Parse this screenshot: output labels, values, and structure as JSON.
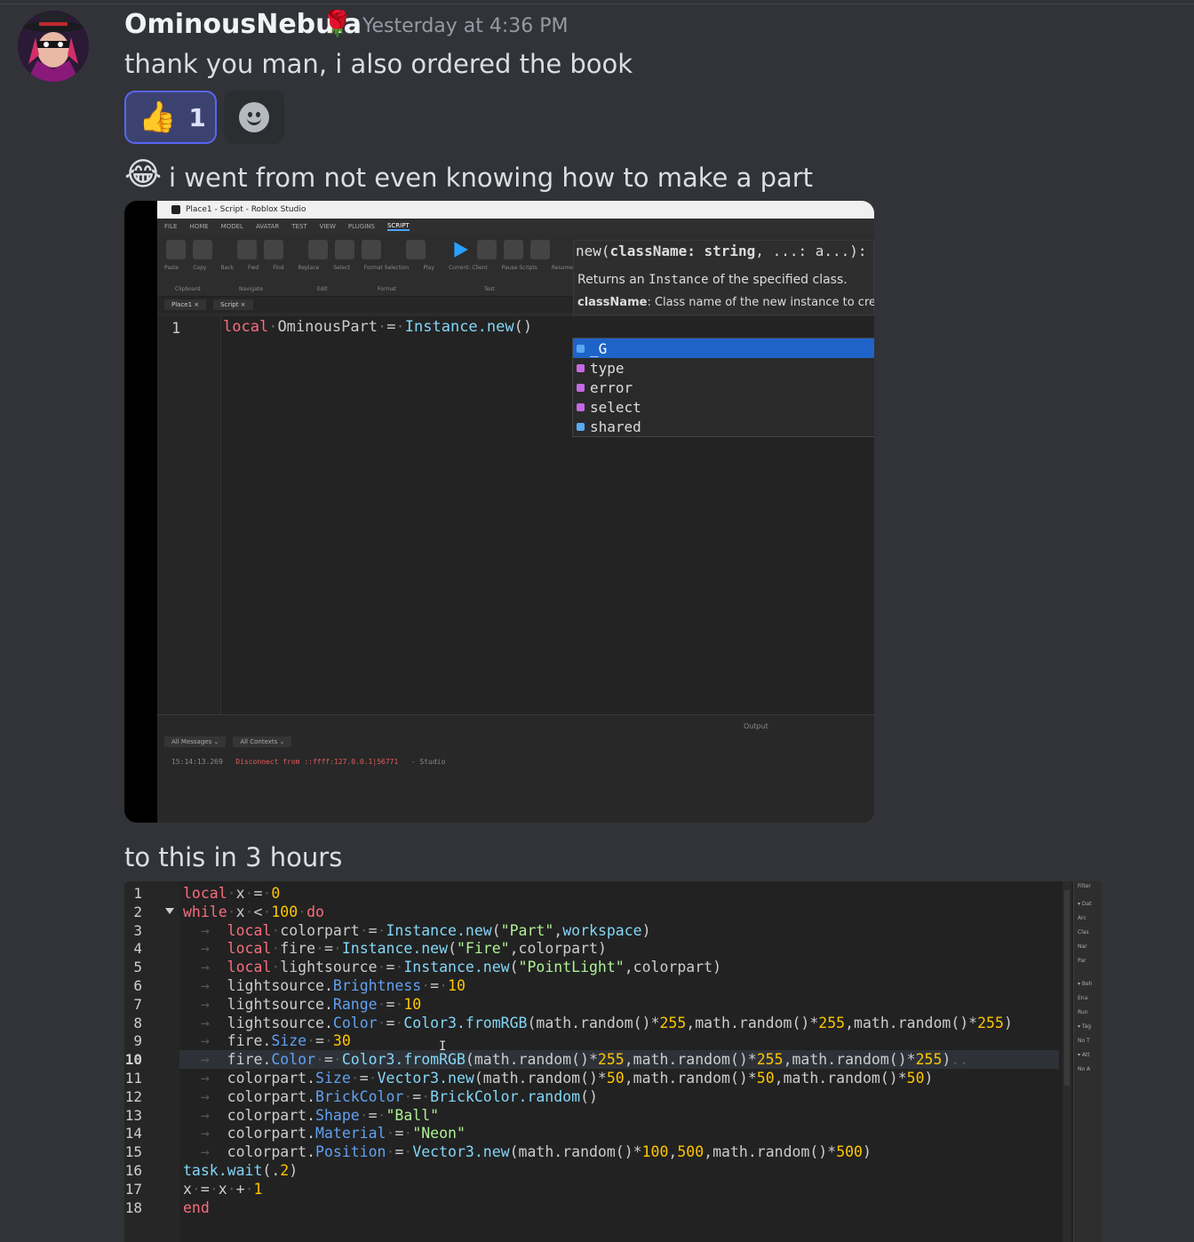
{
  "message": {
    "username": "OminousNebula",
    "username_badge": "🌹",
    "timestamp": "Yesterday at 4:36 PM",
    "line1": "thank you man, i also ordered the book",
    "reaction": {
      "emoji": "👍",
      "count": "1"
    },
    "line2_emoji": "😂",
    "line2": "i went from not even knowing how to make a part",
    "line3": "to this in 3 hours"
  },
  "studio": {
    "window_title": "Place1 - Script - Roblox Studio",
    "menu": [
      "FILE",
      "HOME",
      "MODEL",
      "AVATAR",
      "TEST",
      "VIEW",
      "PLUGINS",
      "SCRIPT"
    ],
    "ribbon_labels": [
      "Paste",
      "Copy",
      "Back",
      "Fwd",
      "Find",
      "Replace",
      "Select",
      "Format Selection",
      "Play",
      "Current: Client",
      "Pause Scripts",
      "Resume Scripts"
    ],
    "ribbon_groups": [
      "Clipboard",
      "Navigate",
      "Edit",
      "Format",
      "Test"
    ],
    "tabs": [
      "Place1 ×",
      "Script ×"
    ],
    "line_number": "1",
    "code": {
      "kw": "local",
      "ident": "OminousPart",
      "eq": "=",
      "call": "Instance.new",
      "paren": "()"
    },
    "tooltip": {
      "sig_prefix": "new(",
      "sig_param": "className: string",
      "sig_rest": ", ...: a...):",
      "desc_pre": "Returns an ",
      "desc_code": "Instance",
      "desc_post": " of the specified class.",
      "param_name": "className",
      "param_desc": ": Class name of the new instance to cre"
    },
    "autocomplete": [
      "_G",
      "type",
      "error",
      "select",
      "shared"
    ],
    "output": {
      "title": "Output",
      "filters": [
        "All Messages ⌄",
        "All Contexts ⌄"
      ],
      "time": "15:14:13.269",
      "msg": "Disconnect from ::ffff:127.0.0.1|56771",
      "source": "-  Studio"
    }
  },
  "code2": {
    "line_numbers": [
      "1",
      "2",
      "3",
      "4",
      "5",
      "6",
      "7",
      "8",
      "9",
      "10",
      "11",
      "12",
      "13",
      "14",
      "15",
      "16",
      "17",
      "18"
    ],
    "side_panel": [
      "Filter",
      "▾ Dat",
      "Arc",
      "Clas",
      "Nar",
      "Par",
      "▾ Beh",
      "Ena",
      "Run",
      "▾ Tag",
      "No T",
      "▾ Att",
      "No A"
    ]
  }
}
